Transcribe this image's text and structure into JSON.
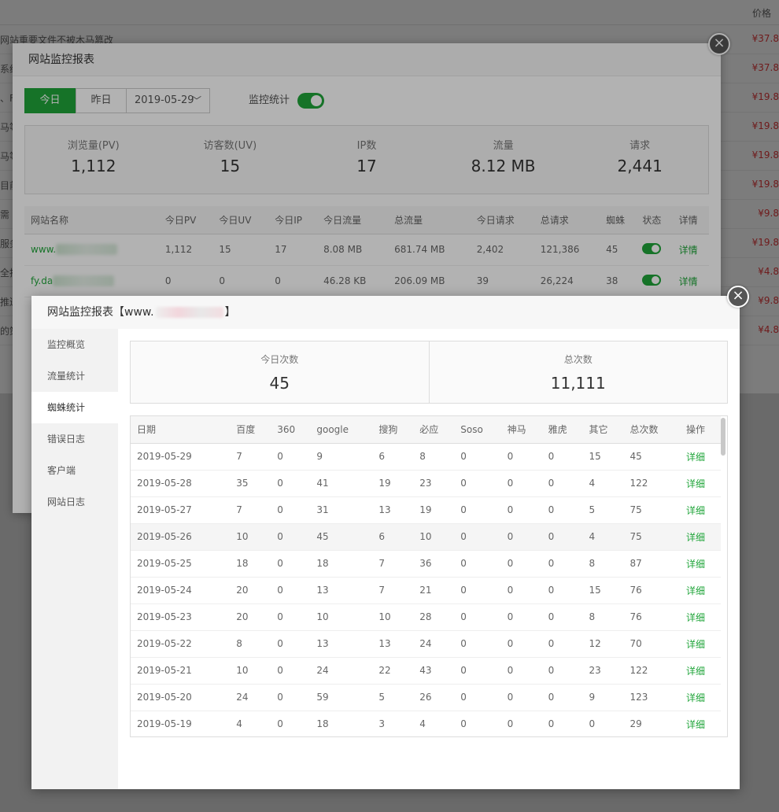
{
  "background": {
    "price_header": "价格",
    "rows": [
      {
        "name": "网站重要文件不被木马篡改",
        "price": "¥37.8"
      },
      {
        "name": "系统",
        "price": "¥37.8"
      },
      {
        "name": "、F",
        "price": "¥19.8"
      },
      {
        "name": "马等",
        "price": "¥19.8"
      },
      {
        "name": "马等",
        "price": "¥19.8"
      },
      {
        "name": "目前",
        "price": "¥19.8"
      },
      {
        "name": "需",
        "price": "¥9.8"
      },
      {
        "name": "服务",
        "price": "¥19.8"
      },
      {
        "name": "全持",
        "price": "¥4.8"
      },
      {
        "name": "推送",
        "price": "¥9.8"
      },
      {
        "name": "的策",
        "price": "¥4.8"
      }
    ]
  },
  "modal1": {
    "title": "网站监控报表",
    "tab_today": "今日",
    "tab_yesterday": "昨日",
    "date": "2019-05-29",
    "monitor_label": "监控统计",
    "monitor_on": true,
    "stats": [
      {
        "label": "浏览量(PV)",
        "value": "1,112"
      },
      {
        "label": "访客数(UV)",
        "value": "15"
      },
      {
        "label": "IP数",
        "value": "17"
      },
      {
        "label": "流量",
        "value": "8.12 MB"
      },
      {
        "label": "请求",
        "value": "2,441"
      }
    ],
    "table": {
      "headers": [
        "网站名称",
        "今日PV",
        "今日UV",
        "今日IP",
        "今日流量",
        "总流量",
        "今日请求",
        "总请求",
        "蜘蛛",
        "状态",
        "详情"
      ],
      "rows": [
        {
          "site": "www.",
          "pv": "1,112",
          "uv": "15",
          "ip": "17",
          "flow": "8.08 MB",
          "total_flow": "681.74 MB",
          "req": "2,402",
          "total_req": "121,386",
          "spider": "45",
          "detail": "详情"
        },
        {
          "site": "fy.da",
          "pv": "0",
          "uv": "0",
          "ip": "0",
          "flow": "46.28 KB",
          "total_flow": "206.09 MB",
          "req": "39",
          "total_req": "26,224",
          "spider": "38",
          "detail": "详情"
        }
      ]
    }
  },
  "modal2": {
    "title_prefix": "网站监控报表【www.",
    "title_suffix": "】",
    "side_items": [
      "监控概览",
      "流量统计",
      "蜘蛛统计",
      "错误日志",
      "客户端",
      "网站日志"
    ],
    "active_side": 2,
    "today_label": "今日次数",
    "today_value": "45",
    "total_label": "总次数",
    "total_value": "11,111",
    "headers": [
      "日期",
      "百度",
      "360",
      "google",
      "搜狗",
      "必应",
      "Soso",
      "神马",
      "雅虎",
      "其它",
      "总次数",
      "操作"
    ],
    "rows": [
      [
        "2019-05-29",
        "7",
        "0",
        "9",
        "6",
        "8",
        "0",
        "0",
        "0",
        "15",
        "45",
        "详细"
      ],
      [
        "2019-05-28",
        "35",
        "0",
        "41",
        "19",
        "23",
        "0",
        "0",
        "0",
        "4",
        "122",
        "详细"
      ],
      [
        "2019-05-27",
        "7",
        "0",
        "31",
        "13",
        "19",
        "0",
        "0",
        "0",
        "5",
        "75",
        "详细"
      ],
      [
        "2019-05-26",
        "10",
        "0",
        "45",
        "6",
        "10",
        "0",
        "0",
        "0",
        "4",
        "75",
        "详细"
      ],
      [
        "2019-05-25",
        "18",
        "0",
        "18",
        "7",
        "36",
        "0",
        "0",
        "0",
        "8",
        "87",
        "详细"
      ],
      [
        "2019-05-24",
        "20",
        "0",
        "13",
        "7",
        "21",
        "0",
        "0",
        "0",
        "15",
        "76",
        "详细"
      ],
      [
        "2019-05-23",
        "20",
        "0",
        "10",
        "10",
        "28",
        "0",
        "0",
        "0",
        "8",
        "76",
        "详细"
      ],
      [
        "2019-05-22",
        "8",
        "0",
        "13",
        "13",
        "24",
        "0",
        "0",
        "0",
        "12",
        "70",
        "详细"
      ],
      [
        "2019-05-21",
        "10",
        "0",
        "24",
        "22",
        "43",
        "0",
        "0",
        "0",
        "23",
        "122",
        "详细"
      ],
      [
        "2019-05-20",
        "24",
        "0",
        "59",
        "5",
        "26",
        "0",
        "0",
        "0",
        "9",
        "123",
        "详细"
      ],
      [
        "2019-05-19",
        "4",
        "0",
        "18",
        "3",
        "4",
        "0",
        "0",
        "0",
        "0",
        "29",
        "详细"
      ]
    ]
  },
  "colors": {
    "accent": "#20a53a",
    "price": "#e4393c"
  }
}
